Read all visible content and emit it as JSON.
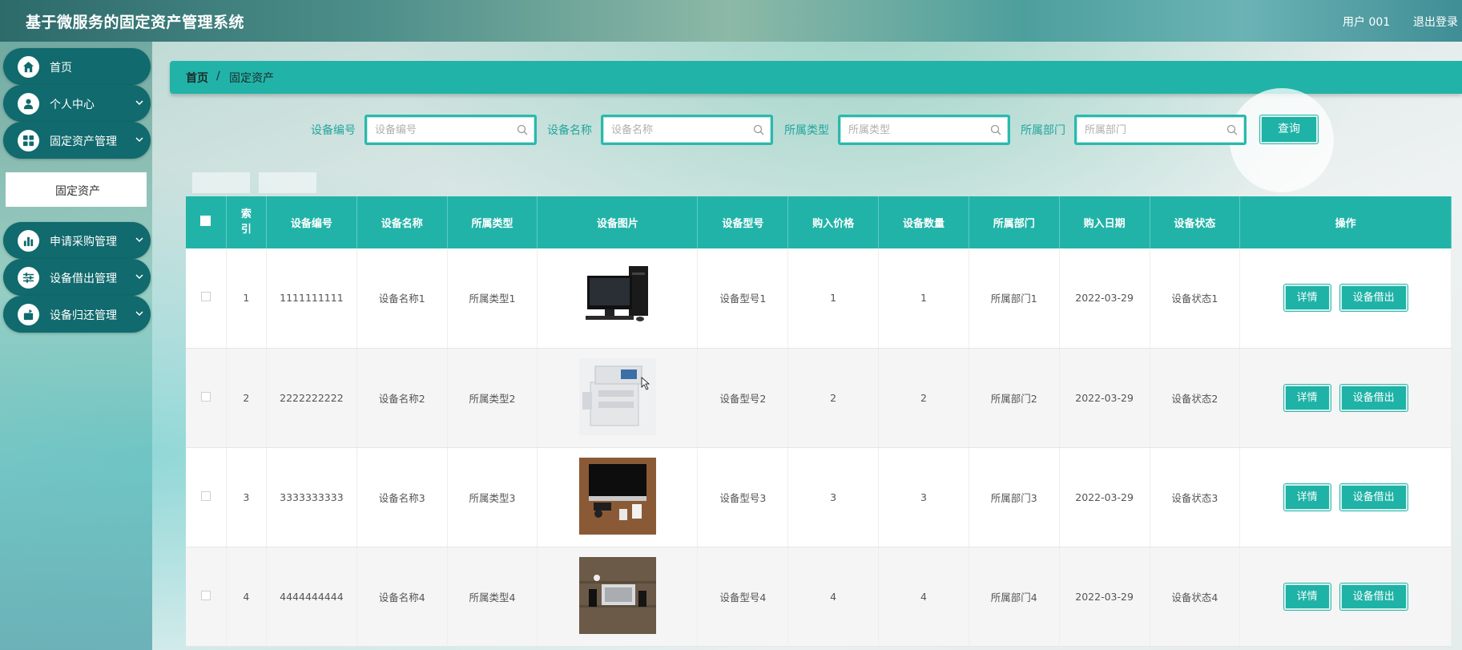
{
  "header": {
    "title": "基于微服务的固定资产管理系统",
    "user": "用户 001",
    "logout": "退出登录"
  },
  "sidebar": {
    "items": [
      {
        "label": "首页",
        "icon": "home-icon"
      },
      {
        "label": "个人中心",
        "icon": "user-icon"
      },
      {
        "label": "固定资产管理",
        "icon": "grid-icon"
      },
      {
        "label": "申请采购管理",
        "icon": "bar-chart-icon"
      },
      {
        "label": "设备借出管理",
        "icon": "sliders-icon"
      },
      {
        "label": "设备归还管理",
        "icon": "return-icon"
      }
    ],
    "submenu_active": "固定资产"
  },
  "breadcrumb": {
    "home": "首页",
    "sep": "/",
    "current": "固定资产"
  },
  "search": {
    "fields": [
      {
        "label": "设备编号",
        "placeholder": "设备编号"
      },
      {
        "label": "设备名称",
        "placeholder": "设备名称"
      },
      {
        "label": "所属类型",
        "placeholder": "所属类型"
      },
      {
        "label": "所属部门",
        "placeholder": "所属部门"
      }
    ],
    "button": "查询"
  },
  "table": {
    "headers": [
      "索引",
      "设备编号",
      "设备名称",
      "所属类型",
      "设备图片",
      "设备型号",
      "购入价格",
      "设备数量",
      "所属部门",
      "购入日期",
      "设备状态",
      "操作"
    ],
    "rows": [
      {
        "index": "1",
        "code": "1111111111",
        "name": "设备名称1",
        "type": "所属类型1",
        "image": "desktop-computer",
        "model": "设备型号1",
        "price": "1",
        "qty": "1",
        "dept": "所属部门1",
        "date": "2022-03-29",
        "status": "设备状态1"
      },
      {
        "index": "2",
        "code": "2222222222",
        "name": "设备名称2",
        "type": "所属类型2",
        "image": "copier-machine",
        "model": "设备型号2",
        "price": "2",
        "qty": "2",
        "dept": "所属部门2",
        "date": "2022-03-29",
        "status": "设备状态2"
      },
      {
        "index": "3",
        "code": "3333333333",
        "name": "设备名称3",
        "type": "所属类型3",
        "image": "laptop-on-desk",
        "model": "设备型号3",
        "price": "3",
        "qty": "3",
        "dept": "所属部门3",
        "date": "2022-03-29",
        "status": "设备状态3"
      },
      {
        "index": "4",
        "code": "4444444444",
        "name": "设备名称4",
        "type": "所属类型4",
        "image": "laptop-phone-desk",
        "model": "设备型号4",
        "price": "4",
        "qty": "4",
        "dept": "所属部门4",
        "date": "2022-03-29",
        "status": "设备状态4"
      }
    ],
    "actions": {
      "detail": "详情",
      "borrow": "设备借出"
    }
  },
  "colors": {
    "accent": "#22b3a8",
    "menu": "#116a6d"
  }
}
